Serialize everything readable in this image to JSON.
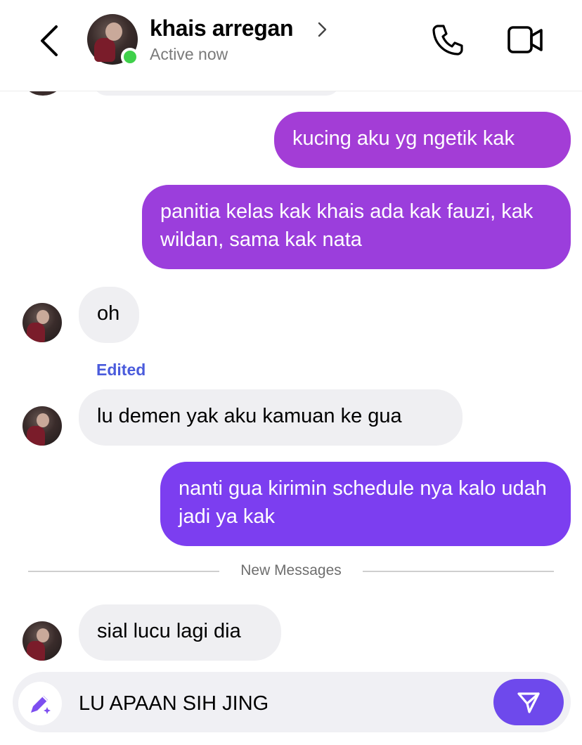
{
  "header": {
    "contact_name": "khais arregan",
    "status": "Active now"
  },
  "messages": [
    {
      "direction": "out",
      "text": "kucing aku yg ngetik kak"
    },
    {
      "direction": "out",
      "text": "panitia kelas kak khais ada kak fauzi, kak wildan, sama kak nata"
    },
    {
      "direction": "in",
      "text": "oh"
    },
    {
      "direction": "in",
      "label": "Edited",
      "text": "lu demen yak aku kamuan ke gua"
    },
    {
      "direction": "out",
      "text": "nanti gua kirimin schedule nya kalo udah jadi ya kak"
    },
    {
      "direction": "in",
      "text": "sial lucu lagi dia"
    }
  ],
  "divider": {
    "label": "New Messages"
  },
  "composer": {
    "value": "LU APAAN SIH JING"
  },
  "colors": {
    "outgoing_1": "#a33dd6",
    "outgoing_2": "#9b3edc",
    "outgoing_3": "#7c3ef0",
    "incoming": "#efeff2",
    "accent": "#6e49ec",
    "online": "#3fd04a",
    "edited": "#4a5bdc"
  },
  "icons": {
    "back": "chevron-left-icon",
    "call": "phone-icon",
    "video": "video-camera-icon",
    "compose": "pencil-sparkle-icon",
    "send": "paper-plane-icon"
  }
}
